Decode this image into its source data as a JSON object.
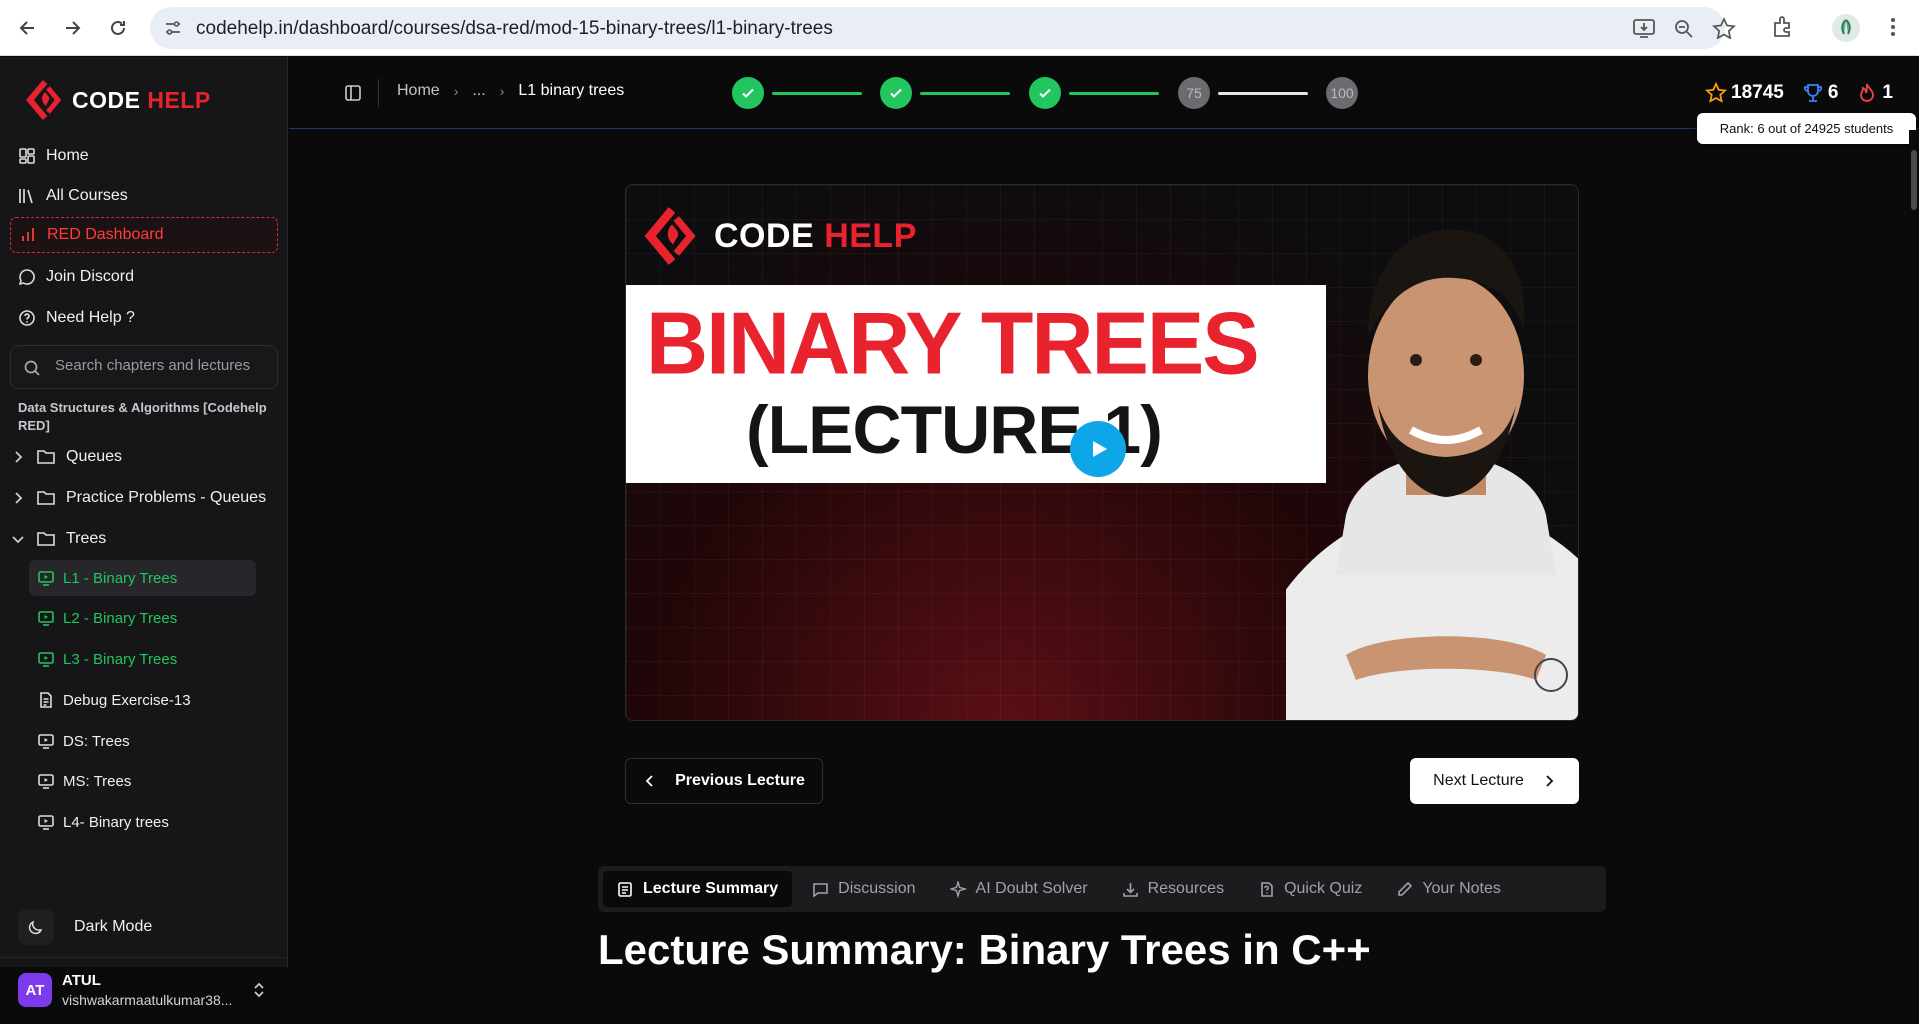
{
  "browser": {
    "url": "codehelp.in/dashboard/courses/dsa-red/mod-15-binary-trees/l1-binary-trees"
  },
  "brand": {
    "name_white": "CODE",
    "name_red": "HELP",
    "red": "#e8232e"
  },
  "sidebar": {
    "menu": [
      {
        "label": "Home",
        "icon": "home-grid-icon"
      },
      {
        "label": "All Courses",
        "icon": "books-icon"
      },
      {
        "label": "RED Dashboard",
        "icon": "bar-chart-icon"
      },
      {
        "label": "Join Discord",
        "icon": "chat-icon"
      },
      {
        "label": "Need Help ?",
        "icon": "help-circle-icon"
      }
    ],
    "search_placeholder": "Search chapters and lectures",
    "course_title": "Data Structures & Algorithms [Codehelp RED]",
    "folders": [
      {
        "label": "Queues",
        "expanded": false
      },
      {
        "label": "Practice Problems - Queues",
        "expanded": false
      },
      {
        "label": "Trees",
        "expanded": true
      }
    ],
    "lectures": [
      {
        "label": "L1 - Binary Trees",
        "status": "completed-current"
      },
      {
        "label": "L2 - Binary Trees",
        "status": "completed"
      },
      {
        "label": "L3 - Binary Trees",
        "status": "completed"
      },
      {
        "label": "Debug Exercise-13",
        "status": "pending"
      },
      {
        "label": "DS: Trees",
        "status": "pending"
      },
      {
        "label": "MS: Trees",
        "status": "pending"
      },
      {
        "label": "L4- Binary trees",
        "status": "pending"
      }
    ],
    "dark_mode_label": "Dark Mode",
    "user": {
      "initials": "AT",
      "name": "ATUL",
      "email": "vishwakarmaatulkumar38..."
    }
  },
  "topbar": {
    "breadcrumb": [
      "Home",
      "...",
      "L1 binary trees"
    ],
    "progress_steps": [
      "done",
      "done",
      "done",
      "75",
      "100"
    ],
    "stats": {
      "stars": "18745",
      "rank": "6",
      "streak": "1"
    },
    "rank_tooltip": "Rank: 6 out of 24925 students"
  },
  "video": {
    "thumbnail_title": "BINARY TREES",
    "thumbnail_subtitle": "(LECTURE-1)"
  },
  "nav": {
    "prev_label": "Previous Lecture",
    "next_label": "Next Lecture"
  },
  "tabs": [
    {
      "label": "Lecture Summary",
      "icon": "summary-icon",
      "active": true
    },
    {
      "label": "Discussion",
      "icon": "chat-bubble-icon",
      "active": false
    },
    {
      "label": "AI Doubt Solver",
      "icon": "sparkle-icon",
      "active": false
    },
    {
      "label": "Resources",
      "icon": "download-icon",
      "active": false
    },
    {
      "label": "Quick Quiz",
      "icon": "quiz-icon",
      "active": false
    },
    {
      "label": "Your Notes",
      "icon": "pencil-icon",
      "active": false
    }
  ],
  "content": {
    "heading": "Lecture Summary: Binary Trees in C++"
  },
  "colors": {
    "accent_green": "#22c55e",
    "accent_red": "#e8232e",
    "play_blue": "#0ea5e9"
  }
}
